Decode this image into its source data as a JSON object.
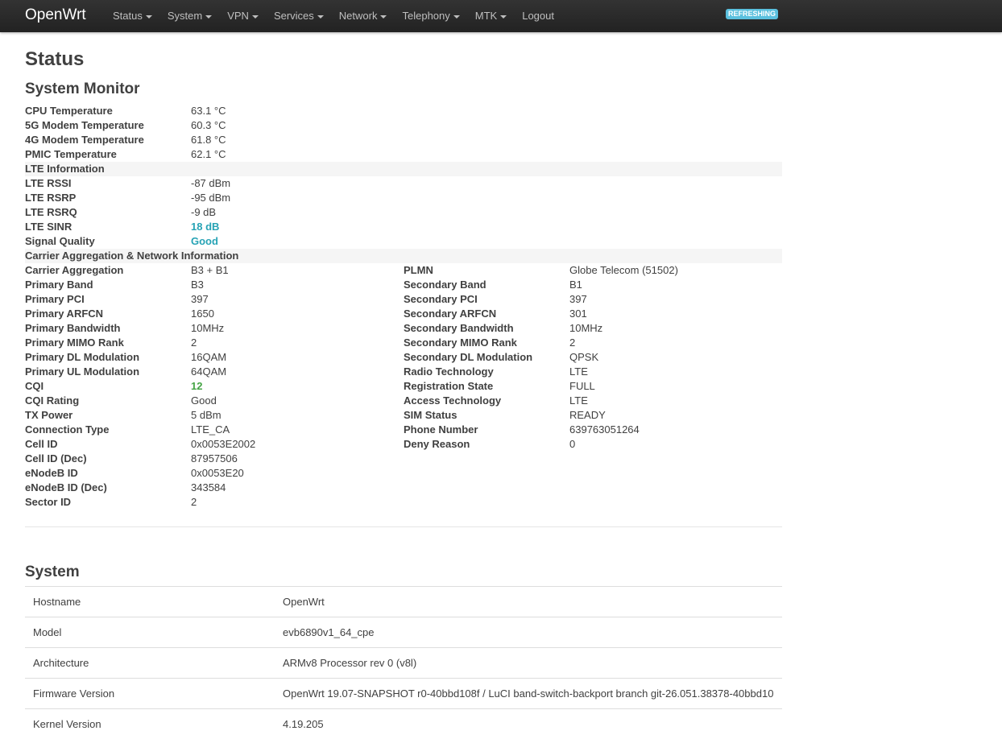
{
  "nav": {
    "brand": "OpenWrt",
    "items": [
      {
        "label": "Status",
        "dropdown": true
      },
      {
        "label": "System",
        "dropdown": true
      },
      {
        "label": "VPN",
        "dropdown": true
      },
      {
        "label": "Services",
        "dropdown": true
      },
      {
        "label": "Network",
        "dropdown": true
      },
      {
        "label": "Telephony",
        "dropdown": true
      },
      {
        "label": "MTK",
        "dropdown": true
      },
      {
        "label": "Logout",
        "dropdown": false
      }
    ],
    "badge": "REFRESHING"
  },
  "page": {
    "title": "Status"
  },
  "monitor": {
    "title": "System Monitor",
    "temps": [
      {
        "label": "CPU Temperature",
        "value": "63.1 °C"
      },
      {
        "label": "5G Modem Temperature",
        "value": "60.3 °C"
      },
      {
        "label": "4G Modem Temperature",
        "value": "61.8 °C"
      },
      {
        "label": "PMIC Temperature",
        "value": "62.1 °C"
      }
    ],
    "lte_header": "LTE Information",
    "lte": [
      {
        "label": "LTE RSSI",
        "value": "-87 dBm"
      },
      {
        "label": "LTE RSRP",
        "value": "-95 dBm"
      },
      {
        "label": "LTE RSRQ",
        "value": "-9 dB"
      },
      {
        "label": "LTE SINR",
        "value": "18 dB"
      },
      {
        "label": "Signal Quality",
        "value": "Good"
      }
    ],
    "ca_header": "Carrier Aggregation & Network Information",
    "ca_left": [
      {
        "label": "Carrier Aggregation",
        "value": "B3 + B1"
      },
      {
        "label": "Primary Band",
        "value": "B3"
      },
      {
        "label": "Primary PCI",
        "value": "397"
      },
      {
        "label": "Primary ARFCN",
        "value": "1650"
      },
      {
        "label": "Primary Bandwidth",
        "value": "10MHz"
      },
      {
        "label": "Primary MIMO Rank",
        "value": "2"
      },
      {
        "label": "Primary DL Modulation",
        "value": "16QAM"
      },
      {
        "label": "Primary UL Modulation",
        "value": "64QAM"
      },
      {
        "label": "CQI",
        "value": "12"
      },
      {
        "label": "CQI Rating",
        "value": "Good"
      },
      {
        "label": "TX Power",
        "value": "5 dBm"
      },
      {
        "label": "Connection Type",
        "value": "LTE_CA"
      },
      {
        "label": "Cell ID",
        "value": "0x0053E2002"
      },
      {
        "label": "Cell ID (Dec)",
        "value": "87957506"
      },
      {
        "label": "eNodeB ID",
        "value": "0x0053E20"
      },
      {
        "label": "eNodeB ID (Dec)",
        "value": "343584"
      },
      {
        "label": "Sector ID",
        "value": "2"
      }
    ],
    "ca_right": [
      {
        "label": "PLMN",
        "value": "Globe Telecom (51502)"
      },
      {
        "label": "Secondary Band",
        "value": "B1"
      },
      {
        "label": "Secondary PCI",
        "value": "397"
      },
      {
        "label": "Secondary ARFCN",
        "value": "301"
      },
      {
        "label": "Secondary Bandwidth",
        "value": "10MHz"
      },
      {
        "label": "Secondary MIMO Rank",
        "value": "2"
      },
      {
        "label": "Secondary DL Modulation",
        "value": "QPSK"
      },
      {
        "label": "Radio Technology",
        "value": "LTE"
      },
      {
        "label": "Registration State",
        "value": "FULL"
      },
      {
        "label": "Access Technology",
        "value": "LTE"
      },
      {
        "label": "SIM Status",
        "value": "READY"
      },
      {
        "label": "Phone Number",
        "value": "639763051264"
      },
      {
        "label": "Deny Reason",
        "value": "0"
      }
    ]
  },
  "system": {
    "title": "System",
    "rows": [
      {
        "label": "Hostname",
        "value": "OpenWrt"
      },
      {
        "label": "Model",
        "value": "evb6890v1_64_cpe"
      },
      {
        "label": "Architecture",
        "value": "ARMv8 Processor rev 0 (v8l)"
      },
      {
        "label": "Firmware Version",
        "value": "OpenWrt 19.07-SNAPSHOT r0-40bbd108f / LuCI band-switch-backport branch git-26.051.38378-40bbd10"
      },
      {
        "label": "Kernel Version",
        "value": "4.19.205"
      }
    ]
  },
  "colors": {
    "sinr": "#27a3b5",
    "signal_quality": "#27a3b5",
    "cqi": "#46a546",
    "badge": "#5bc0de"
  }
}
